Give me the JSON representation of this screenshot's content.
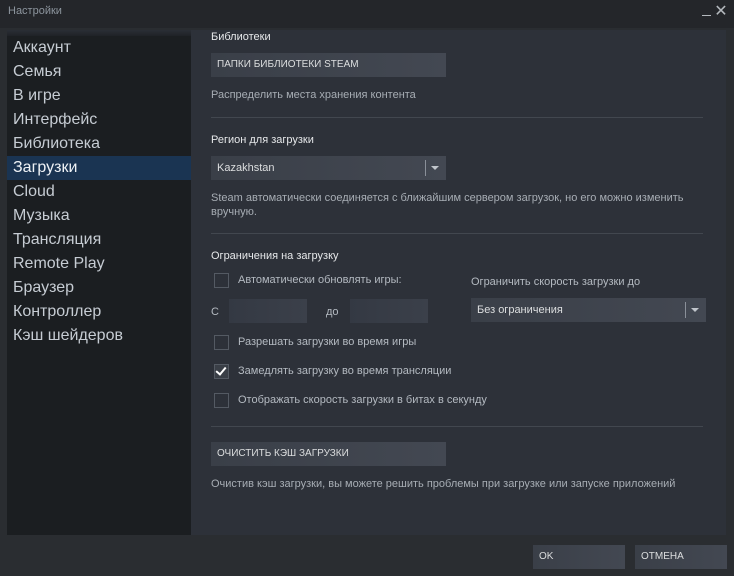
{
  "window": {
    "title": "Настройки",
    "minimize_icon": "minimize-icon",
    "close_icon": "close-icon",
    "close_glyph": "✕"
  },
  "sidebar": {
    "items": [
      {
        "label": "Аккаунт",
        "active": false
      },
      {
        "label": "Семья",
        "active": false
      },
      {
        "label": "В игре",
        "active": false
      },
      {
        "label": "Интерфейс",
        "active": false
      },
      {
        "label": "Библиотека",
        "active": false
      },
      {
        "label": "Загрузки",
        "active": true
      },
      {
        "label": "Cloud",
        "active": false
      },
      {
        "label": "Музыка",
        "active": false
      },
      {
        "label": "Трансляция",
        "active": false
      },
      {
        "label": "Remote Play",
        "active": false
      },
      {
        "label": "Браузер",
        "active": false
      },
      {
        "label": "Контроллер",
        "active": false
      },
      {
        "label": "Кэш шейдеров",
        "active": false
      }
    ]
  },
  "libraries": {
    "title": "Библиотеки",
    "button_label": "ПАПКИ БИБЛИОТЕКИ STEAM",
    "description": "Распределить места хранения контента"
  },
  "region": {
    "title": "Регион для загрузки",
    "selected": "Kazakhstan",
    "description": "Steam автоматически соединяется с ближайшим сервером загрузок, но его можно изменить вручную."
  },
  "restrictions": {
    "title": "Ограничения на загрузку",
    "auto_update": {
      "label": "Автоматически обновлять игры:",
      "checked": false
    },
    "from_label": "С",
    "from_value": "",
    "to_label": "до",
    "to_value": "",
    "speed_limit_label": "Ограничить скорость загрузки до",
    "speed_limit_selected": "Без ограничения",
    "options": [
      {
        "label": "Разрешать загрузки во время игры",
        "checked": false
      },
      {
        "label": "Замедлять загрузку во время трансляции",
        "checked": true
      },
      {
        "label": "Отображать скорость загрузки в битах в секунду",
        "checked": false
      }
    ]
  },
  "cache": {
    "button_label": "ОЧИСТИТЬ КЭШ ЗАГРУЗКИ",
    "description": "Очистив кэш загрузки, вы можете решить проблемы при загрузке или запуске приложений"
  },
  "footer": {
    "ok_label": "OK",
    "cancel_label": "ОТМЕНА"
  },
  "colors": {
    "background": "#2a2d31",
    "sidebar": "#1b1e21",
    "sidebar_active": "#1a3452",
    "content": "#2d3139",
    "button": "#3d424b"
  }
}
